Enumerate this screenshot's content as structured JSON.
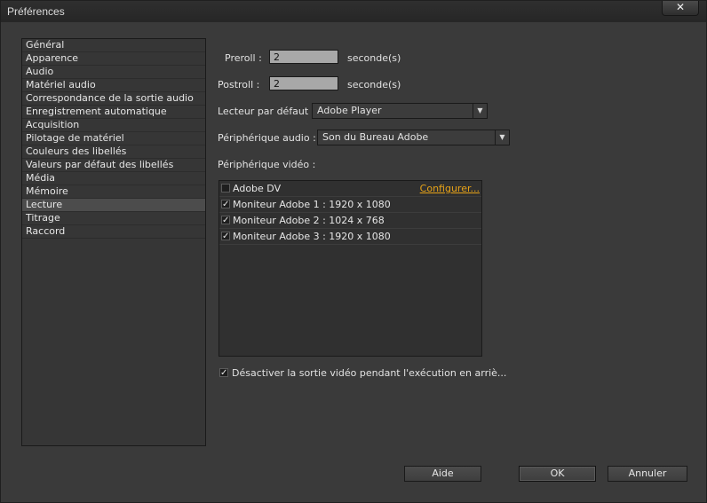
{
  "window": {
    "title": "Préférences",
    "close_symbol": "✕"
  },
  "categories": [
    {
      "label": "Général"
    },
    {
      "label": "Apparence"
    },
    {
      "label": "Audio"
    },
    {
      "label": "Matériel audio"
    },
    {
      "label": "Correspondance de la sortie audio"
    },
    {
      "label": "Enregistrement automatique"
    },
    {
      "label": "Acquisition"
    },
    {
      "label": "Pilotage de matériel"
    },
    {
      "label": "Couleurs des libellés"
    },
    {
      "label": "Valeurs par défaut des libellés"
    },
    {
      "label": "Média"
    },
    {
      "label": "Mémoire"
    },
    {
      "label": "Lecture",
      "selected": true
    },
    {
      "label": "Titrage"
    },
    {
      "label": "Raccord"
    }
  ],
  "preroll": {
    "label": "Preroll :",
    "value": "2",
    "unit": "seconde(s)"
  },
  "postroll": {
    "label": "Postroll :",
    "value": "2",
    "unit": "seconde(s)"
  },
  "default_player": {
    "label": "Lecteur par défaut :",
    "value": "Adobe Player"
  },
  "audio_device": {
    "label": "Périphérique audio :",
    "value": "Son du Bureau Adobe"
  },
  "video_device": {
    "label": "Périphérique vidéo :",
    "items": [
      {
        "label": "Adobe DV",
        "checked": false,
        "action": "Configurer..."
      },
      {
        "label": "Moniteur Adobe 1 : 1920 x 1080",
        "checked": true
      },
      {
        "label": "Moniteur Adobe 2 : 1024 x 768",
        "checked": true
      },
      {
        "label": "Moniteur Adobe 3 : 1920 x 1080",
        "checked": true
      }
    ]
  },
  "disable_video_output": {
    "label": "Désactiver la sortie vidéo pendant l'exécution en arriè...",
    "checked": true
  },
  "buttons": {
    "help": "Aide",
    "ok": "OK",
    "cancel": "Annuler"
  },
  "check_symbol": "✓",
  "dropdown_arrow": "▼",
  "colors": {
    "accent_link": "#e8a317",
    "background": "#3a3a3a"
  }
}
